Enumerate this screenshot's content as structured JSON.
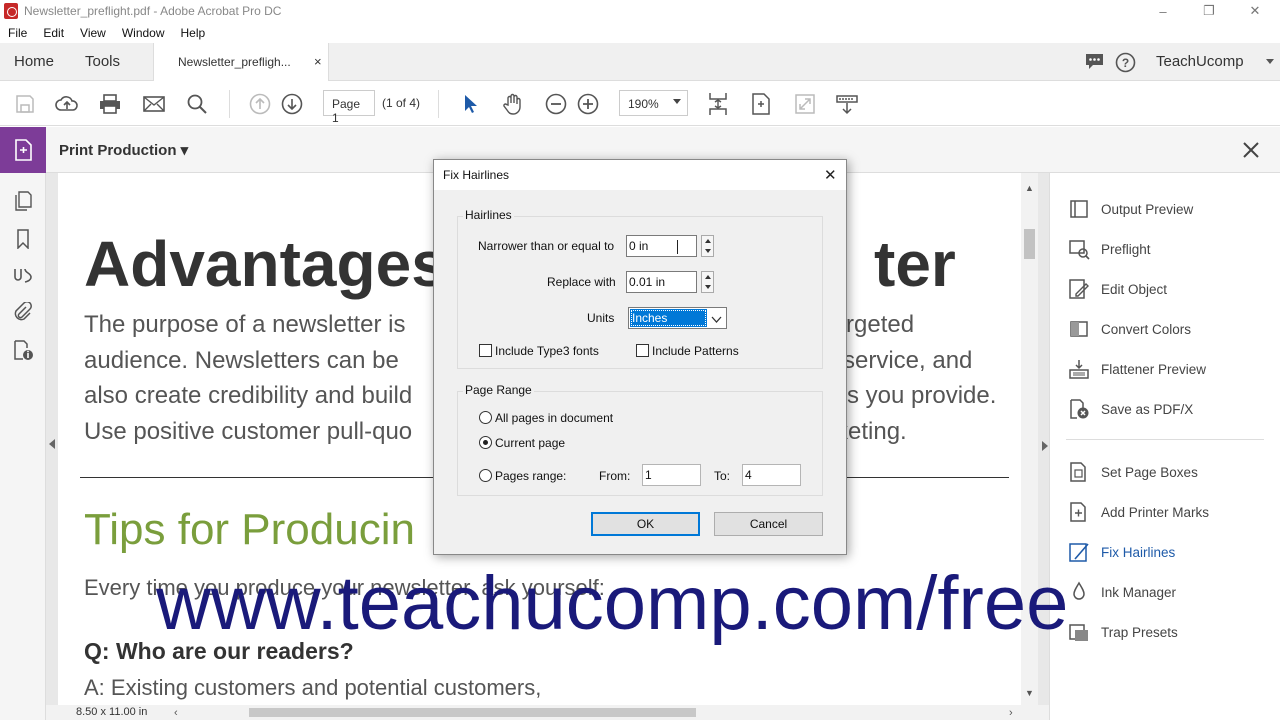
{
  "window": {
    "title": "Newsletter_preflight.pdf - Adobe Acrobat Pro DC",
    "controls": {
      "minimize": "–",
      "restore": "❐",
      "close": "✕"
    }
  },
  "menu": [
    "File",
    "Edit",
    "View",
    "Window",
    "Help"
  ],
  "nav_tabs": {
    "home": "Home",
    "tools": "Tools",
    "document": "Newsletter_prefligh...",
    "document_close": "×"
  },
  "header_right": {
    "account": "TeachUcomp",
    "help": "?"
  },
  "toolbar": {
    "page_value": "Page 1",
    "page_of": "(1 of 4)",
    "zoom": "190%"
  },
  "tool_header": {
    "name": "Print Production ▾",
    "close": "✕"
  },
  "document": {
    "heading_left": "Advantages",
    "heading_right": "ter",
    "para_lines": [
      {
        "left": "The purpose of a newsletter is",
        "right": "o a targeted"
      },
      {
        "left": "audience. Newsletters can be",
        "right": "or service, and"
      },
      {
        "left": "also create credibility and build",
        "right": "s you provide."
      },
      {
        "left": "Use positive customer pull-quo",
        "right": "keting."
      }
    ],
    "subheading": "Tips for Producin",
    "every_line": "Every time you produce your newsletter, ask yourself:",
    "question": "Q:  Who are our readers?",
    "answer": "A:   Existing customers and potential customers,",
    "page_size": "8.50 x 11.00 in"
  },
  "right_panel": {
    "items": [
      {
        "label": "Output Preview",
        "icon": "output-preview-icon"
      },
      {
        "label": "Preflight",
        "icon": "preflight-icon"
      },
      {
        "label": "Edit Object",
        "icon": "edit-object-icon"
      },
      {
        "label": "Convert Colors",
        "icon": "convert-colors-icon"
      },
      {
        "label": "Flattener Preview",
        "icon": "flattener-preview-icon"
      },
      {
        "label": "Save as PDF/X",
        "icon": "save-pdfx-icon"
      },
      {
        "label": "Set Page Boxes",
        "icon": "set-page-boxes-icon"
      },
      {
        "label": "Add Printer Marks",
        "icon": "printer-marks-icon"
      },
      {
        "label": "Fix Hairlines",
        "icon": "fix-hairlines-icon"
      },
      {
        "label": "Ink Manager",
        "icon": "ink-manager-icon"
      },
      {
        "label": "Trap Presets",
        "icon": "trap-presets-icon"
      }
    ],
    "active": "Fix Hairlines"
  },
  "dialog": {
    "title": "Fix Hairlines",
    "close": "✕",
    "hairlines_group": "Hairlines",
    "narrower_label": "Narrower than or equal to",
    "narrower_value": "0 in",
    "replace_label": "Replace with",
    "replace_value": "0.01 in",
    "units_label": "Units",
    "units_value": "Inches",
    "include_type3": "Include Type3 fonts",
    "include_type3_checked": false,
    "include_patterns": "Include Patterns",
    "include_patterns_checked": false,
    "page_range_group": "Page Range",
    "all_pages": "All pages in document",
    "current_page": "Current page",
    "pages_range": "Pages range:",
    "selected_range": "Current page",
    "from_label": "From:",
    "from_value": "1",
    "to_label": "To:",
    "to_value": "4",
    "ok": "OK",
    "cancel": "Cancel"
  },
  "watermark": "www.teachucomp.com/free",
  "colors": {
    "accent_purple": "#7d3c98",
    "active_blue": "#1e5aa8",
    "heading_green": "#7a9e3c",
    "watermark_navy": "#1a1a7a",
    "select_blue": "#0078d7"
  }
}
